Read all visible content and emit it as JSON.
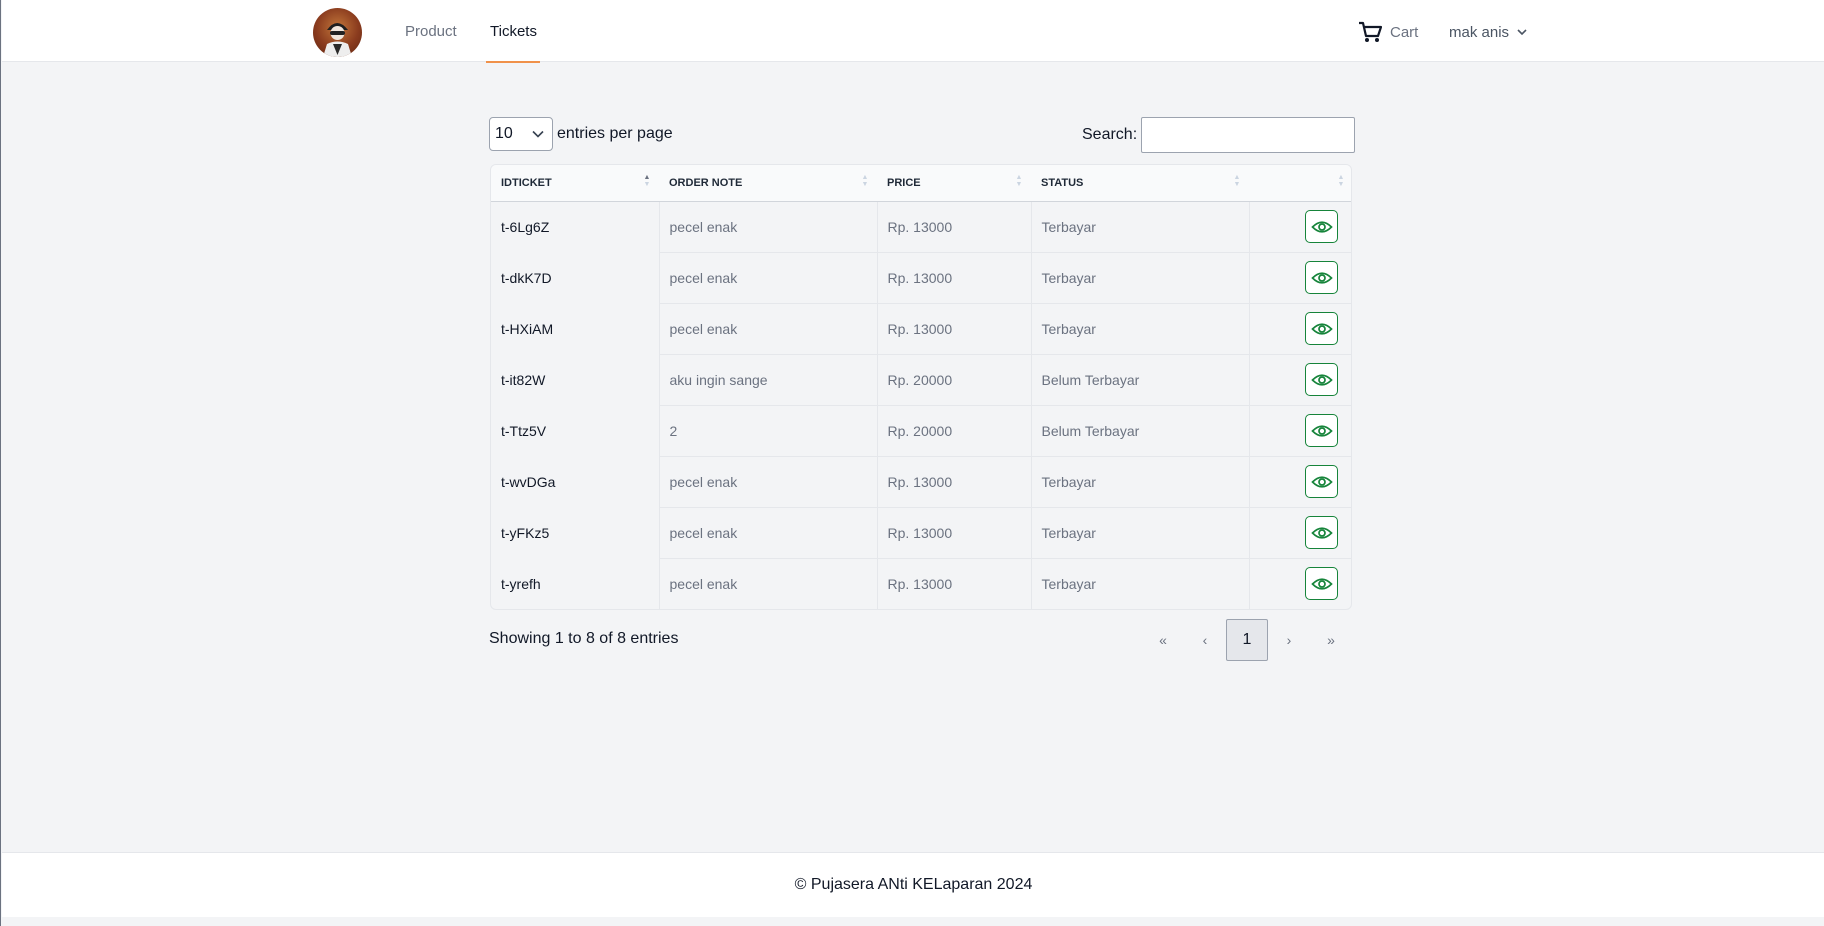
{
  "nav": {
    "items": [
      {
        "label": "Product"
      },
      {
        "label": "Tickets"
      }
    ],
    "cart_label": "Cart",
    "user_name": "mak anis",
    "accent_color": "#f0914a"
  },
  "table_controls": {
    "entries_value": "10",
    "entries_label": "entries per page",
    "search_label": "Search:",
    "search_value": ""
  },
  "table": {
    "columns": [
      "IDTICKET",
      "ORDER NOTE",
      "PRICE",
      "STATUS",
      ""
    ],
    "sort_column": "IDTICKET",
    "rows": [
      {
        "id": "t-6Lg6Z",
        "note": "pecel enak",
        "price": "Rp. 13000",
        "status": "Terbayar"
      },
      {
        "id": "t-dkK7D",
        "note": "pecel enak",
        "price": "Rp. 13000",
        "status": "Terbayar"
      },
      {
        "id": "t-HXiAM",
        "note": "pecel enak",
        "price": "Rp. 13000",
        "status": "Terbayar"
      },
      {
        "id": "t-it82W",
        "note": "aku ingin sange",
        "price": "Rp. 20000",
        "status": "Belum Terbayar"
      },
      {
        "id": "t-Ttz5V",
        "note": "2",
        "price": "Rp. 20000",
        "status": "Belum Terbayar"
      },
      {
        "id": "t-wvDGa",
        "note": "pecel enak",
        "price": "Rp. 13000",
        "status": "Terbayar"
      },
      {
        "id": "t-yFKz5",
        "note": "pecel enak",
        "price": "Rp. 13000",
        "status": "Terbayar"
      },
      {
        "id": "t-yrefh",
        "note": "pecel enak",
        "price": "Rp. 13000",
        "status": "Terbayar"
      }
    ],
    "action_icon": "eye-icon",
    "action_color": "#16843a"
  },
  "pagination": {
    "info": "Showing 1 to 8 of 8 entries",
    "first": "«",
    "prev": "‹",
    "current": "1",
    "next": "›",
    "last": "»"
  },
  "footer": {
    "text": "© Pujasera ANti KELaparan 2024"
  }
}
